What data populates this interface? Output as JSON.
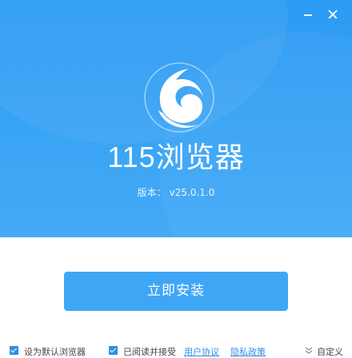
{
  "window": {
    "minimize_icon": "minimize-icon",
    "close_icon": "close-icon"
  },
  "header": {
    "logo_icon": "swirl-logo-icon",
    "product_name": "115浏览器",
    "version_label": "版本：",
    "version_value": "v25.0.1.0"
  },
  "install": {
    "button_label": "立即安装"
  },
  "footer": {
    "default_browser_label": "设为默认浏览器",
    "agree_label": "已阅读并接受",
    "user_agreement": "用户协议",
    "privacy_policy": "隐私政策",
    "custom_label": "自定义"
  },
  "colors": {
    "header_top": "#2c9bf3",
    "header_bottom": "#44aaf6",
    "button": "#3fa6f5",
    "link": "#2f8fe6"
  }
}
